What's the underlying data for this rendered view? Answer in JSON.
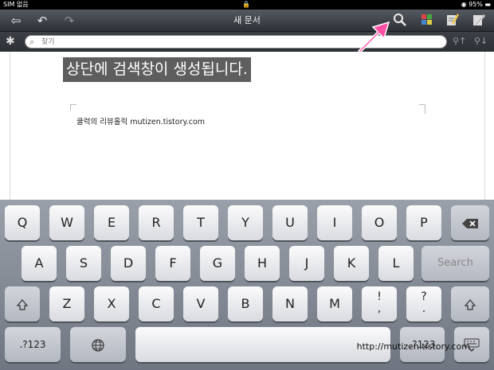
{
  "status": {
    "carrier": "SIM 없음",
    "battery": "95%"
  },
  "toolbar": {
    "title": "새 문서"
  },
  "search": {
    "placeholder": "찾기"
  },
  "document": {
    "overlay_caption": "상단에 검색창이 생성됩니다.",
    "body_text": "쿨럭의 리뷰홀릭  mutizen.tistory.com"
  },
  "keyboard": {
    "row1": [
      "Q",
      "W",
      "E",
      "R",
      "T",
      "Y",
      "U",
      "I",
      "O",
      "P"
    ],
    "row2": [
      "A",
      "S",
      "D",
      "F",
      "G",
      "H",
      "J",
      "K",
      "L"
    ],
    "row3": [
      "Z",
      "X",
      "C",
      "V",
      "B",
      "N",
      "M"
    ],
    "punct1": [
      "!",
      ","
    ],
    "punct2": [
      "?",
      "."
    ],
    "search_label": "Search",
    "numbers_label": ".?123",
    "numbers_label_right": ".?123"
  },
  "watermark": "http://mutizen.tistory.com"
}
